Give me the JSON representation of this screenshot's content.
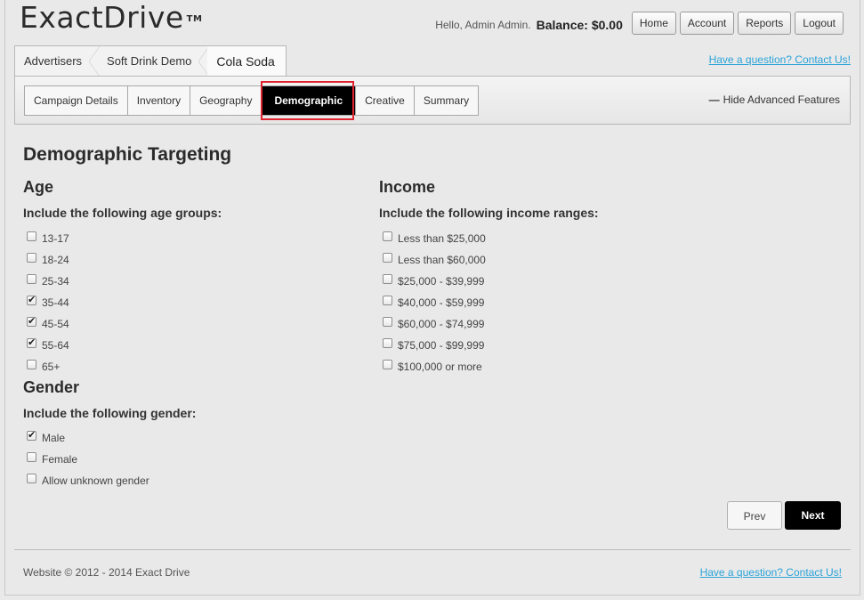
{
  "header": {
    "logo": "ExactDrive",
    "trademark": "TM",
    "greeting": "Hello, Admin Admin.",
    "balance": "Balance: $0.00",
    "nav": [
      "Home",
      "Account",
      "Reports",
      "Logout"
    ]
  },
  "breadcrumb": [
    "Advertisers",
    "Soft Drink Demo",
    "Cola Soda"
  ],
  "help_link": "Have a question? Contact Us!",
  "tabs": [
    "Campaign Details",
    "Inventory",
    "Geography",
    "Demographic",
    "Creative",
    "Summary"
  ],
  "active_tab": "Demographic",
  "hide_advanced": "Hide Advanced Features",
  "page_title": "Demographic Targeting",
  "age": {
    "heading": "Age",
    "subheading": "Include the following age groups:",
    "options": [
      {
        "label": "13-17",
        "checked": false
      },
      {
        "label": "18-24",
        "checked": false
      },
      {
        "label": "25-34",
        "checked": false
      },
      {
        "label": "35-44",
        "checked": true
      },
      {
        "label": "45-54",
        "checked": true
      },
      {
        "label": "55-64",
        "checked": true
      },
      {
        "label": "65+",
        "checked": false
      }
    ]
  },
  "gender": {
    "heading": "Gender",
    "subheading": "Include the following gender:",
    "options": [
      {
        "label": "Male",
        "checked": true
      },
      {
        "label": "Female",
        "checked": false
      },
      {
        "label": "Allow unknown gender",
        "checked": false
      }
    ]
  },
  "income": {
    "heading": "Income",
    "subheading": "Include the following income ranges:",
    "options": [
      {
        "label": "Less than $25,000",
        "checked": false
      },
      {
        "label": "Less than $60,000",
        "checked": false
      },
      {
        "label": "$25,000 - $39,999",
        "checked": false
      },
      {
        "label": "$40,000 - $59,999",
        "checked": false
      },
      {
        "label": "$60,000 - $74,999",
        "checked": false
      },
      {
        "label": "$75,000 - $99,999",
        "checked": false
      },
      {
        "label": "$100,000 or more",
        "checked": false
      }
    ]
  },
  "buttons": {
    "prev": "Prev",
    "next": "Next"
  },
  "footer": {
    "copyright": "Website © 2012 - 2014 Exact Drive",
    "help_link": "Have a question? Contact Us!"
  },
  "colors": {
    "highlight": "#e0242f",
    "link": "#2aa3d9",
    "active_tab_bg": "#000000"
  }
}
